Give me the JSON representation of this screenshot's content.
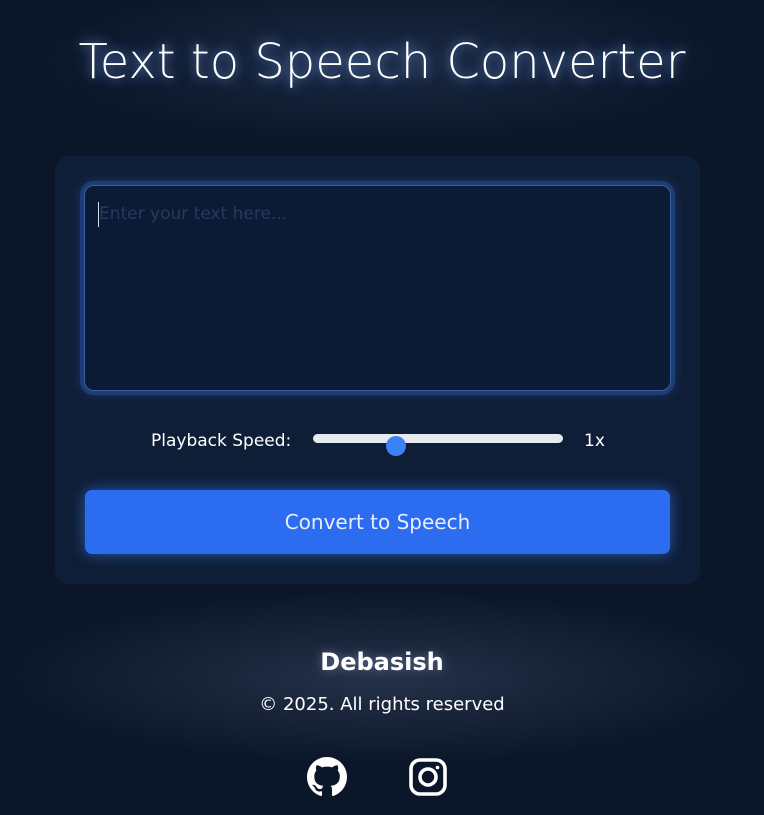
{
  "page": {
    "title": "Text to Speech Converter"
  },
  "editor": {
    "placeholder": "Enter your text here...",
    "value": ""
  },
  "speed": {
    "label": "Playback Speed:",
    "value_text": "1x",
    "value": 1,
    "min": 0.5,
    "max": 2,
    "step": 0.1
  },
  "actions": {
    "convert_label": "Convert to Speech"
  },
  "footer": {
    "author": "Debasish",
    "copyright": "© 2025. All rights reserved",
    "social": [
      {
        "icon": "github-icon"
      },
      {
        "icon": "instagram-icon"
      }
    ]
  },
  "colors": {
    "background": "#0c1629",
    "card": "#0f1e37",
    "accent": "#2b6cf0",
    "slider_thumb": "#3b82f6"
  }
}
